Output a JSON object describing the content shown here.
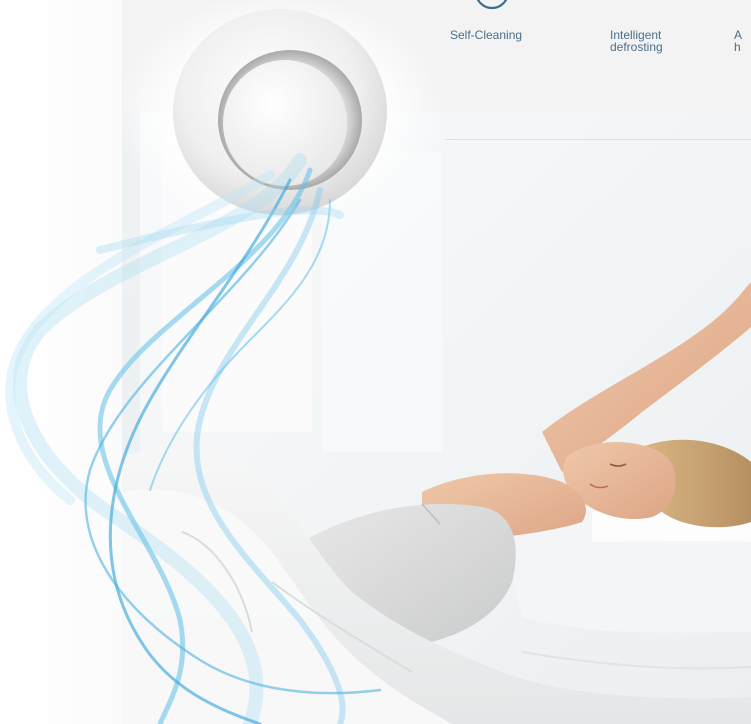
{
  "features": {
    "items": [
      {
        "label": "Self-Cleaning",
        "icon": "circle-icon"
      },
      {
        "label": "Intelligent\ndefrosting",
        "icon": ""
      },
      {
        "label": "A\nh",
        "icon": ""
      }
    ]
  },
  "colors": {
    "feature_text": "#4a6f8a",
    "feature_band": "#f3f3f3",
    "icon_stroke": "#3d6e8e",
    "airflow_light": "#9fd6f0",
    "airflow_dark": "#3aa8dc"
  },
  "image": {
    "subject": "woman-stretching-in-bed-photo",
    "product": "ceiling-air-diffuser"
  }
}
